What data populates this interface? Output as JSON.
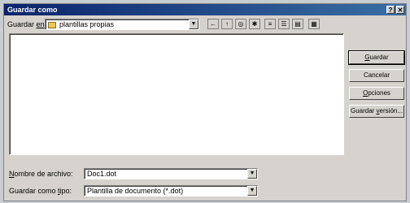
{
  "window": {
    "title": "Guardar como",
    "help_btn": "?",
    "close_btn": "✕"
  },
  "toolbar": {
    "savein_label_prefix": "Guardar ",
    "savein_label_access": "en",
    "savein_label_suffix": ":",
    "savein_value": "plantillas propias",
    "icons": [
      "back-icon",
      "up-folder-icon",
      "search-web-icon",
      "new-folder-icon",
      "list-view-icon",
      "details-view-icon",
      "properties-view-icon",
      "tools-icon"
    ]
  },
  "buttons": {
    "save_access": "G",
    "save_rest": "uardar",
    "cancel": "Cancelar",
    "options_access": "O",
    "options_rest": "pciones",
    "saveversion_prefix": "Guardar ",
    "saveversion_access": "v",
    "saveversion_rest": "ersión..."
  },
  "fields": {
    "filename_label_access": "N",
    "filename_label_rest": "ombre de archivo:",
    "filename_value": "Doc1.dot",
    "filetype_label_prefix": "Guardar como ",
    "filetype_label_access": "t",
    "filetype_label_rest": "ipo:",
    "filetype_value": "Plantilla de documento (*.dot)"
  }
}
